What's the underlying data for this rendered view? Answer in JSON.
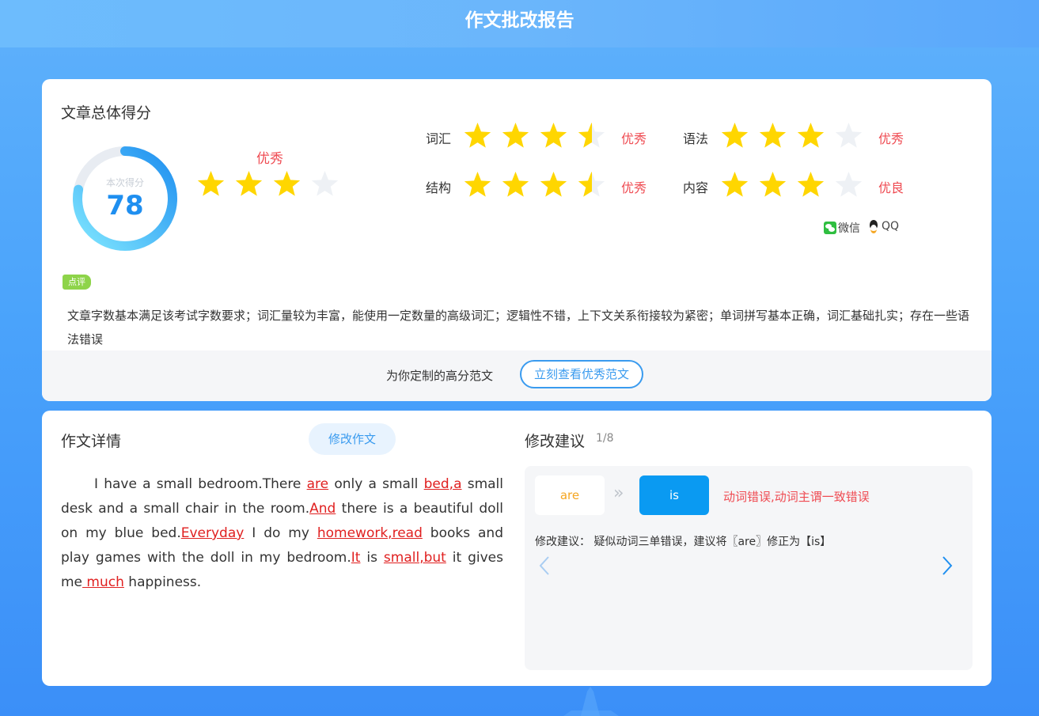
{
  "header": {
    "title": "作文批改报告"
  },
  "overview": {
    "title": "文章总体得分",
    "score_label": "本次得分",
    "score": "78",
    "score_fraction": 0.78,
    "level": "优秀",
    "stars": 3,
    "stars_max": 4,
    "metrics": [
      {
        "name": "词汇",
        "stars": 3.5,
        "level": "优秀"
      },
      {
        "name": "语法",
        "stars": 3,
        "level": "优秀"
      },
      {
        "name": "结构",
        "stars": 3.5,
        "level": "优秀"
      },
      {
        "name": "内容",
        "stars": 3,
        "level": "优良"
      }
    ],
    "share": {
      "wechat": "微信",
      "qq": "QQ"
    },
    "comment_tag": "点评",
    "comment": "文章字数基本满足该考试字数要求；词汇量较为丰富，能使用一定数量的高级词汇；逻辑性不错，上下文关系衔接较为紧密；单词拼写基本正确，词汇基础扎实；存在一些语法错误",
    "sample_prompt": "为你定制的高分范文",
    "sample_button": "立刻查看优秀范文"
  },
  "essay": {
    "title": "作文详情",
    "edit_button": "修改作文",
    "segments": [
      {
        "t": "I have a small bedroom.There "
      },
      {
        "t": "are",
        "e": true
      },
      {
        "t": " only a small "
      },
      {
        "t": "bed,a",
        "e": true
      },
      {
        "t": " small desk and a small chair in the room."
      },
      {
        "t": "And",
        "e": true
      },
      {
        "t": " there is a beautiful doll on my blue bed."
      },
      {
        "t": "Everyday",
        "e": true
      },
      {
        "t": " I do my "
      },
      {
        "t": "homework,read",
        "e": true
      },
      {
        "t": " books and play games with the doll in my bedroom."
      },
      {
        "t": "It",
        "e": true
      },
      {
        "t": " is "
      },
      {
        "t": "small,but",
        "e": true
      },
      {
        "t": " it gives me"
      },
      {
        "t": " much",
        "e": true
      },
      {
        "t": " happiness."
      }
    ]
  },
  "suggestions": {
    "title": "修改建议",
    "current": "1",
    "total": "/8",
    "wrong": "are",
    "correct": "is",
    "error_type": "动词错误,动词主谓一致错误",
    "text": "修改建议： 疑似动词三单错误，建议将〖are〗修正为【is】"
  },
  "colors": {
    "accent": "#1f8ff0",
    "star_on": "#ffd600",
    "star_off": "#eef1f5",
    "error": "#e02020",
    "level": "#ef4b52"
  }
}
